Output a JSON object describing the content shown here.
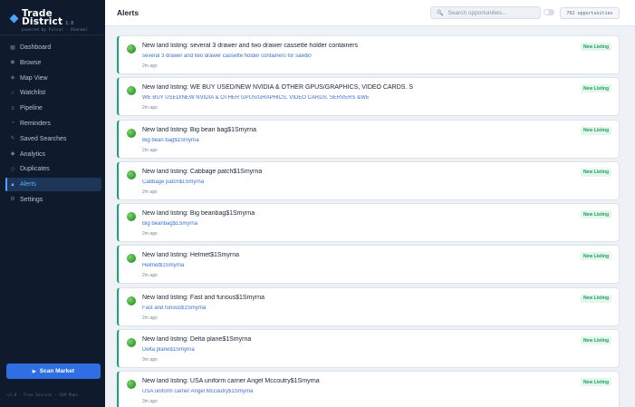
{
  "brand": {
    "name_line1": "Trade",
    "name_line2": "District",
    "version": "1.0",
    "tagline": "powered by Pulsar · Okanmal"
  },
  "sidebar": {
    "items": [
      {
        "label": "Dashboard",
        "icon": "grid-icon",
        "glyph": "▦",
        "active": false
      },
      {
        "label": "Browse",
        "icon": "browse-icon",
        "glyph": "◉",
        "active": false
      },
      {
        "label": "Map View",
        "icon": "map-icon",
        "glyph": "◈",
        "active": false
      },
      {
        "label": "Watchlist",
        "icon": "star-icon",
        "glyph": "☆",
        "active": false
      },
      {
        "label": "Pipeline",
        "icon": "pipeline-icon",
        "glyph": "≡",
        "active": false
      },
      {
        "label": "Reminders",
        "icon": "bell-icon",
        "glyph": "◔",
        "active": false
      },
      {
        "label": "Saved Searches",
        "icon": "bookmark-icon",
        "glyph": "✎",
        "active": false
      },
      {
        "label": "Analytics",
        "icon": "analytics-icon",
        "glyph": "◆",
        "active": false
      },
      {
        "label": "Duplicates",
        "icon": "duplicates-icon",
        "glyph": "◇",
        "active": false
      },
      {
        "label": "Alerts",
        "icon": "alert-icon",
        "glyph": "▲",
        "active": true
      },
      {
        "label": "Settings",
        "icon": "gear-icon",
        "glyph": "⚙",
        "active": false
      }
    ],
    "scan_button": "Scan Market",
    "footer": "v1.0 · Free Sources · OSM Maps"
  },
  "header": {
    "title": "Alerts",
    "search_placeholder": "Search opportunities...",
    "count": "792 opportunities"
  },
  "alerts": [
    {
      "title": "New land listing: several 3 drawer and two drawer cassette holder containers",
      "subtitle": "several 3 drawer and two drawer cassette holder containers for sale$0",
      "time": "2m ago",
      "badge": "New Listing"
    },
    {
      "title": "New land listing: WE BUY USED/NEW NVIDIA & OTHER GPUS/GRAPHICS, VIDEO CARDS. S",
      "subtitle": "WE BUY USED/NEW NVIDIA & OTHER GPUS/GRAPHICS, VIDEO CARDS. SERVERS &WE",
      "time": "2m ago",
      "badge": "New Listing"
    },
    {
      "title": "New land listing: Big bean bag$1Smyrna",
      "subtitle": "Big bean bag$1Smyrna",
      "time": "2m ago",
      "badge": "New Listing"
    },
    {
      "title": "New land listing: Cabbage patch$1Smyrna",
      "subtitle": "Cabbage patch$1Smyrna",
      "time": "2m ago",
      "badge": "New Listing"
    },
    {
      "title": "New land listing: Big beanbag$1Smyrna",
      "subtitle": "Big beanbag$1Smyrna",
      "time": "2m ago",
      "badge": "New Listing"
    },
    {
      "title": "New land listing: Helmet$1Smyrna",
      "subtitle": "Helmet$1Smyrna",
      "time": "2m ago",
      "badge": "New Listing"
    },
    {
      "title": "New land listing: Fast and furious$1Smyrna",
      "subtitle": "Fast and furious$1Smyrna",
      "time": "2m ago",
      "badge": "New Listing"
    },
    {
      "title": "New land listing: Delta plane$1Smyrna",
      "subtitle": "Delta plane$1Smyrna",
      "time": "3m ago",
      "badge": "New Listing"
    },
    {
      "title": "New land listing: USA uniform carrier Angel Mccoutry$1Smyrna",
      "subtitle": "USA uniform carrier Angel Mccoutry$1Smyrna",
      "time": "3m ago",
      "badge": "New Listing"
    }
  ]
}
